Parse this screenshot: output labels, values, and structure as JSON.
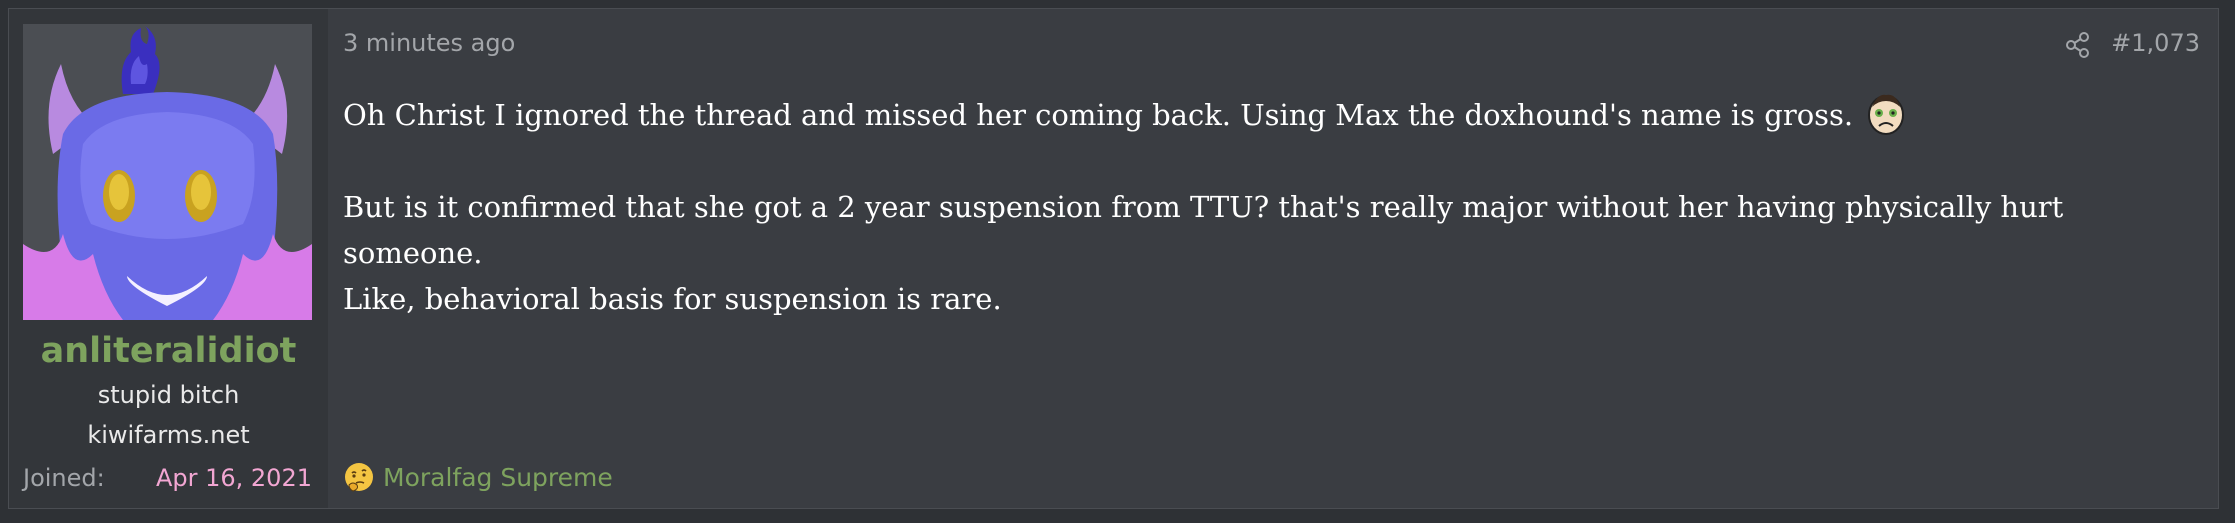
{
  "user": {
    "name": "anliteralidiot",
    "title_line1": "stupid bitch",
    "title_line2": "kiwifarms.net",
    "joined_label": "Joined:",
    "joined_date": "Apr 16, 2021",
    "avatar_icon": "horned-blue-creature-avatar"
  },
  "post": {
    "timestamp": "3 minutes ago",
    "number": "#1,073",
    "share_icon": "share-icon",
    "paragraph1": "Oh Christ I ignored the thread and missed her coming back. Using Max the doxhound's name is gross.",
    "paragraph1_smilie": "sick-face-icon",
    "paragraph2_line1": "But is it confirmed that she got a 2 year suspension from TTU? that's really major without her having physically hurt someone.",
    "paragraph2_line2": "Like, behavioral basis for suspension is rare."
  },
  "trophy": {
    "icon": "thinking-face-icon",
    "label": "Moralfag Supreme"
  },
  "colors": {
    "username": "#7ea35e",
    "joined_date": "#f2a6d2",
    "background": "#3a3d42",
    "sidebar": "#33363a"
  }
}
